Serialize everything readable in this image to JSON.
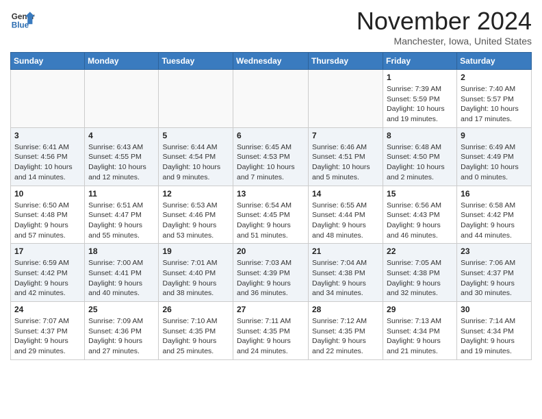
{
  "header": {
    "logo_line1": "General",
    "logo_line2": "Blue",
    "month": "November 2024",
    "location": "Manchester, Iowa, United States"
  },
  "days_of_week": [
    "Sunday",
    "Monday",
    "Tuesday",
    "Wednesday",
    "Thursday",
    "Friday",
    "Saturday"
  ],
  "weeks": [
    [
      {
        "day": "",
        "info": ""
      },
      {
        "day": "",
        "info": ""
      },
      {
        "day": "",
        "info": ""
      },
      {
        "day": "",
        "info": ""
      },
      {
        "day": "",
        "info": ""
      },
      {
        "day": "1",
        "info": "Sunrise: 7:39 AM\nSunset: 5:59 PM\nDaylight: 10 hours\nand 19 minutes."
      },
      {
        "day": "2",
        "info": "Sunrise: 7:40 AM\nSunset: 5:57 PM\nDaylight: 10 hours\nand 17 minutes."
      }
    ],
    [
      {
        "day": "3",
        "info": "Sunrise: 6:41 AM\nSunset: 4:56 PM\nDaylight: 10 hours\nand 14 minutes."
      },
      {
        "day": "4",
        "info": "Sunrise: 6:43 AM\nSunset: 4:55 PM\nDaylight: 10 hours\nand 12 minutes."
      },
      {
        "day": "5",
        "info": "Sunrise: 6:44 AM\nSunset: 4:54 PM\nDaylight: 10 hours\nand 9 minutes."
      },
      {
        "day": "6",
        "info": "Sunrise: 6:45 AM\nSunset: 4:53 PM\nDaylight: 10 hours\nand 7 minutes."
      },
      {
        "day": "7",
        "info": "Sunrise: 6:46 AM\nSunset: 4:51 PM\nDaylight: 10 hours\nand 5 minutes."
      },
      {
        "day": "8",
        "info": "Sunrise: 6:48 AM\nSunset: 4:50 PM\nDaylight: 10 hours\nand 2 minutes."
      },
      {
        "day": "9",
        "info": "Sunrise: 6:49 AM\nSunset: 4:49 PM\nDaylight: 10 hours\nand 0 minutes."
      }
    ],
    [
      {
        "day": "10",
        "info": "Sunrise: 6:50 AM\nSunset: 4:48 PM\nDaylight: 9 hours\nand 57 minutes."
      },
      {
        "day": "11",
        "info": "Sunrise: 6:51 AM\nSunset: 4:47 PM\nDaylight: 9 hours\nand 55 minutes."
      },
      {
        "day": "12",
        "info": "Sunrise: 6:53 AM\nSunset: 4:46 PM\nDaylight: 9 hours\nand 53 minutes."
      },
      {
        "day": "13",
        "info": "Sunrise: 6:54 AM\nSunset: 4:45 PM\nDaylight: 9 hours\nand 51 minutes."
      },
      {
        "day": "14",
        "info": "Sunrise: 6:55 AM\nSunset: 4:44 PM\nDaylight: 9 hours\nand 48 minutes."
      },
      {
        "day": "15",
        "info": "Sunrise: 6:56 AM\nSunset: 4:43 PM\nDaylight: 9 hours\nand 46 minutes."
      },
      {
        "day": "16",
        "info": "Sunrise: 6:58 AM\nSunset: 4:42 PM\nDaylight: 9 hours\nand 44 minutes."
      }
    ],
    [
      {
        "day": "17",
        "info": "Sunrise: 6:59 AM\nSunset: 4:42 PM\nDaylight: 9 hours\nand 42 minutes."
      },
      {
        "day": "18",
        "info": "Sunrise: 7:00 AM\nSunset: 4:41 PM\nDaylight: 9 hours\nand 40 minutes."
      },
      {
        "day": "19",
        "info": "Sunrise: 7:01 AM\nSunset: 4:40 PM\nDaylight: 9 hours\nand 38 minutes."
      },
      {
        "day": "20",
        "info": "Sunrise: 7:03 AM\nSunset: 4:39 PM\nDaylight: 9 hours\nand 36 minutes."
      },
      {
        "day": "21",
        "info": "Sunrise: 7:04 AM\nSunset: 4:38 PM\nDaylight: 9 hours\nand 34 minutes."
      },
      {
        "day": "22",
        "info": "Sunrise: 7:05 AM\nSunset: 4:38 PM\nDaylight: 9 hours\nand 32 minutes."
      },
      {
        "day": "23",
        "info": "Sunrise: 7:06 AM\nSunset: 4:37 PM\nDaylight: 9 hours\nand 30 minutes."
      }
    ],
    [
      {
        "day": "24",
        "info": "Sunrise: 7:07 AM\nSunset: 4:37 PM\nDaylight: 9 hours\nand 29 minutes."
      },
      {
        "day": "25",
        "info": "Sunrise: 7:09 AM\nSunset: 4:36 PM\nDaylight: 9 hours\nand 27 minutes."
      },
      {
        "day": "26",
        "info": "Sunrise: 7:10 AM\nSunset: 4:35 PM\nDaylight: 9 hours\nand 25 minutes."
      },
      {
        "day": "27",
        "info": "Sunrise: 7:11 AM\nSunset: 4:35 PM\nDaylight: 9 hours\nand 24 minutes."
      },
      {
        "day": "28",
        "info": "Sunrise: 7:12 AM\nSunset: 4:35 PM\nDaylight: 9 hours\nand 22 minutes."
      },
      {
        "day": "29",
        "info": "Sunrise: 7:13 AM\nSunset: 4:34 PM\nDaylight: 9 hours\nand 21 minutes."
      },
      {
        "day": "30",
        "info": "Sunrise: 7:14 AM\nSunset: 4:34 PM\nDaylight: 9 hours\nand 19 minutes."
      }
    ]
  ]
}
